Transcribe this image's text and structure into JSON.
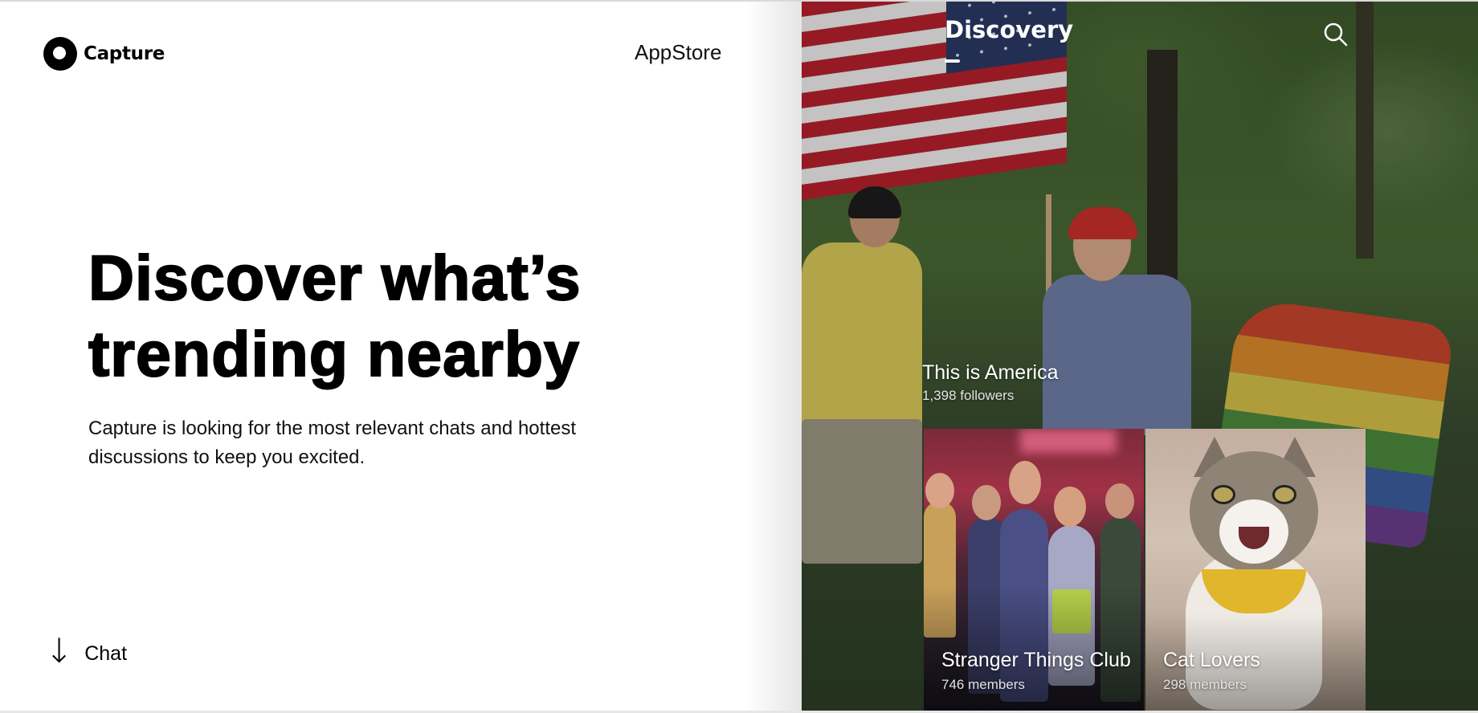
{
  "brand": {
    "name": "Capture"
  },
  "nav": {
    "appstore_label": "AppStore"
  },
  "hero": {
    "headline_line1": "Discover what’s",
    "headline_line2": "trending nearby",
    "description": "Capture is looking for the most relevant chats and hottest discussions to keep you excited."
  },
  "footer": {
    "chat_label": "Chat"
  },
  "discovery": {
    "tab_label": "Discovery",
    "featured": {
      "title": "This is America",
      "subtitle": "1,398 followers"
    },
    "cards": [
      {
        "title": "Stranger Things Club",
        "subtitle": "746 members"
      },
      {
        "title": "Cat Lovers",
        "subtitle": "298 members"
      }
    ]
  },
  "icons": {
    "logo": "capture-logo-icon",
    "search": "search-icon",
    "chat": "arrow-down-icon"
  },
  "colors": {
    "text": "#000000",
    "background": "#ffffff",
    "overlay_text": "#ffffff"
  }
}
